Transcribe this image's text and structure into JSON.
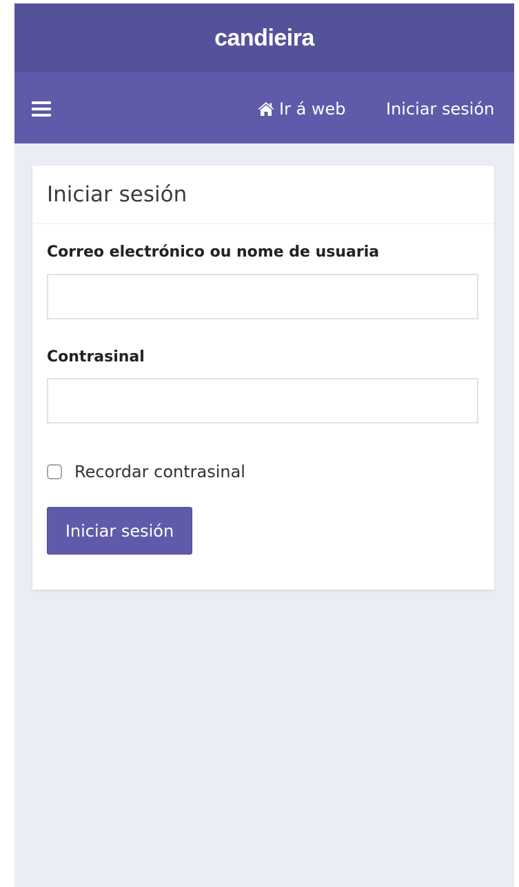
{
  "header": {
    "brand": "candieira"
  },
  "nav": {
    "menu_icon": "hamburger-icon",
    "home_icon": "home-icon",
    "web_link_label": "Ir á web",
    "login_link_label": "Iniciar sesión"
  },
  "login_card": {
    "title": "Iniciar sesión",
    "email_label": "Correo electrónico ou nome de usuaria",
    "email_value": "",
    "password_label": "Contrasinal",
    "password_value": "",
    "remember_label": "Recordar contrasinal",
    "remember_checked": false,
    "submit_label": "Iniciar sesión"
  },
  "colors": {
    "brand_bar": "#55529c",
    "nav_bar": "#5f5aa9",
    "page_background": "#eaedf3",
    "button": "#5f5aa9"
  }
}
